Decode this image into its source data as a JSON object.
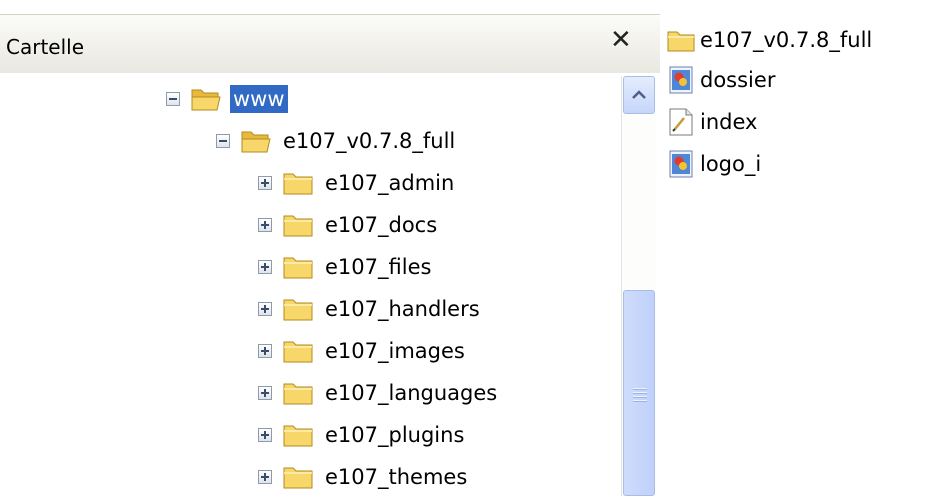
{
  "folders_pane": {
    "title": "Cartelle",
    "close_glyph": "✕",
    "tree": [
      {
        "label": "www",
        "expander": "minus",
        "selected": true
      },
      {
        "label": "e107_v0.7.8_full",
        "expander": "minus",
        "selected": false
      },
      {
        "label": "e107_admin",
        "expander": "plus",
        "selected": false
      },
      {
        "label": "e107_docs",
        "expander": "plus",
        "selected": false
      },
      {
        "label": "e107_files",
        "expander": "plus",
        "selected": false
      },
      {
        "label": "e107_handlers",
        "expander": "plus",
        "selected": false
      },
      {
        "label": "e107_images",
        "expander": "plus",
        "selected": false
      },
      {
        "label": "e107_languages",
        "expander": "plus",
        "selected": false
      },
      {
        "label": "e107_plugins",
        "expander": "plus",
        "selected": false
      },
      {
        "label": "e107_themes",
        "expander": "plus",
        "selected": false
      }
    ]
  },
  "contents_pane": {
    "items": [
      {
        "label": "e107_v0.7.8_full",
        "icon": "folder-icon"
      },
      {
        "label": "dossier",
        "icon": "image-file-icon"
      },
      {
        "label": "index",
        "icon": "text-file-icon"
      },
      {
        "label": "logo_i",
        "icon": "image-file-icon"
      }
    ]
  },
  "colors": {
    "selection": "#316ac5",
    "header": "#ecebe5",
    "scroll_accent": "#c6d6fb",
    "folder_yellow": "#f7d66a"
  }
}
